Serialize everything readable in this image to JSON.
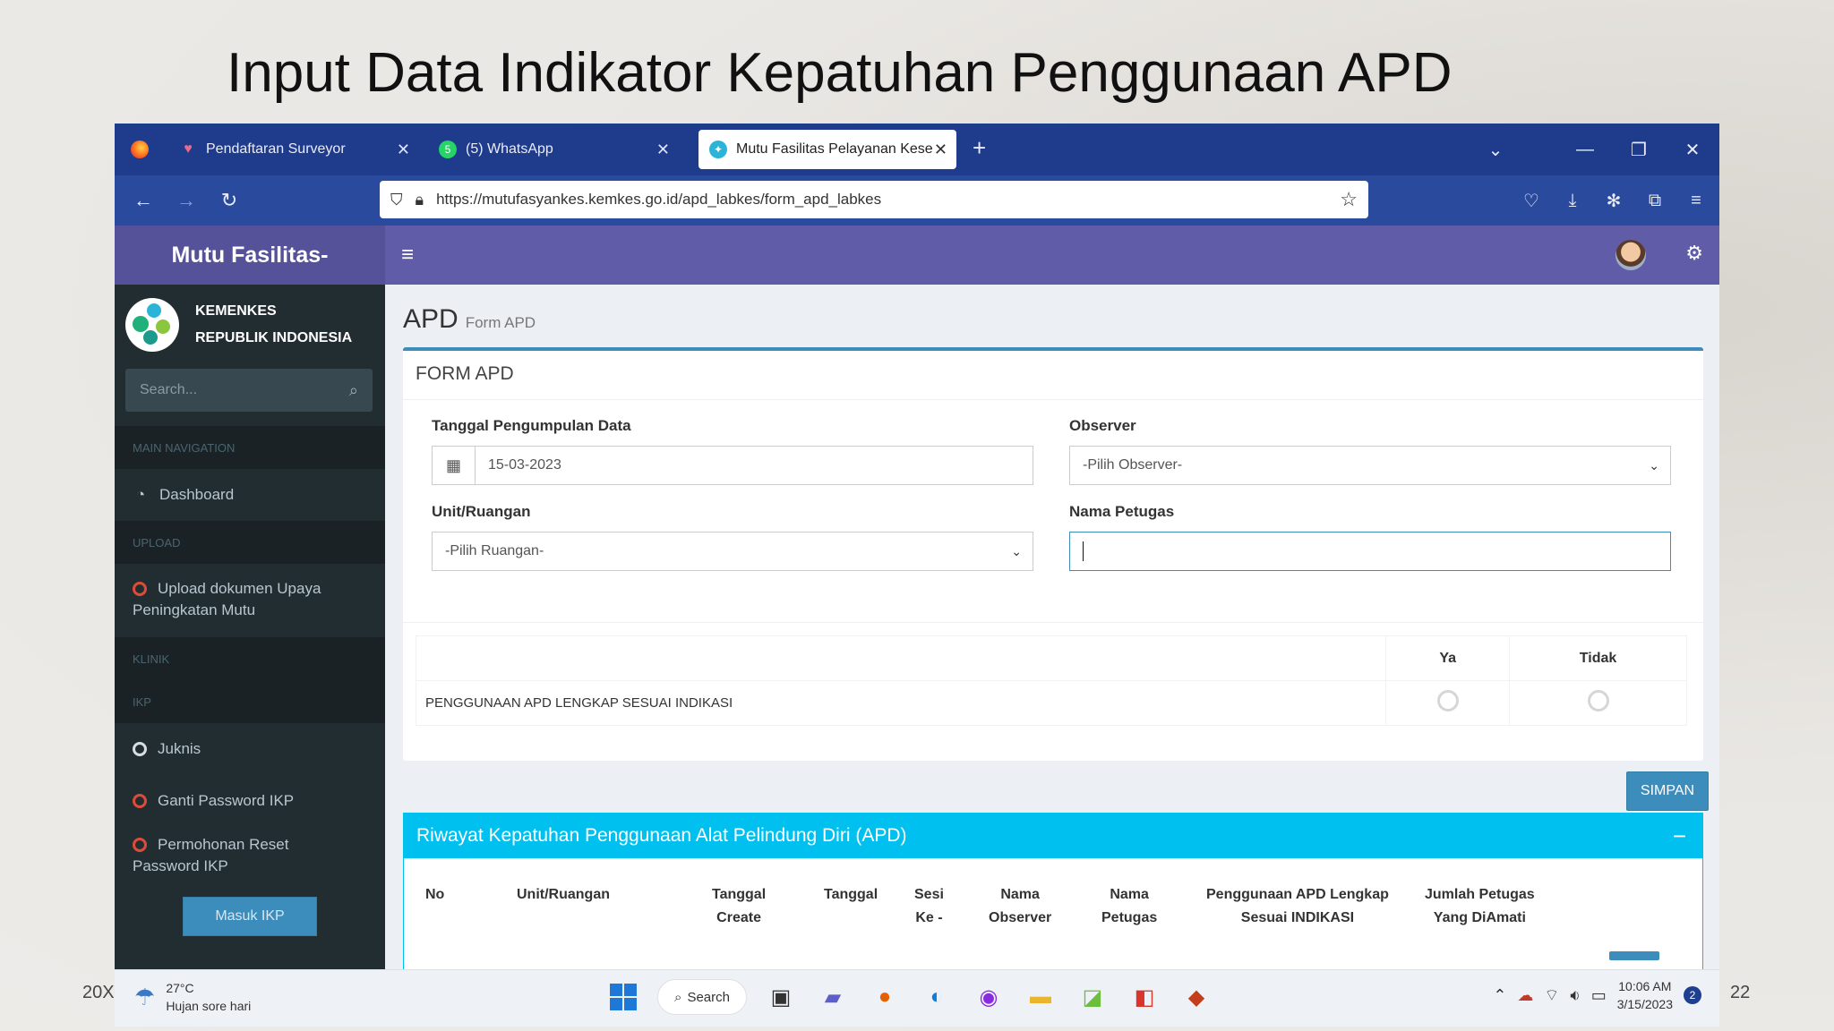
{
  "slide": {
    "title": "Input Data Indikator Kepatuhan Penggunaan APD",
    "footer_left": "20X",
    "footer_right": "22"
  },
  "browser": {
    "tabs": [
      {
        "label": "Pendaftaran Surveyor",
        "icon": "tab-heart-icon",
        "active": false
      },
      {
        "label": "(5) WhatsApp",
        "icon": "whatsapp-icon",
        "active": false
      },
      {
        "label": "Mutu Fasilitas Pelayanan Keseh",
        "icon": "kemenkes-icon",
        "active": true
      }
    ],
    "new_tab": "+",
    "url": "https://mutufasyankes.kemkes.go.id/apd_labkes/form_apd_labkes"
  },
  "app": {
    "brand": "Mutu Fasilitas-",
    "org_line1": "KEMENKES",
    "org_line2": "REPUBLIK INDONESIA",
    "search_placeholder": "Search...",
    "nav_header_main": "MAIN NAVIGATION",
    "nav_dashboard": "Dashboard",
    "nav_header_upload": "UPLOAD",
    "nav_upload_line1": "Upload dokumen Upaya",
    "nav_upload_line2": "Peningkatan Mutu",
    "nav_header_klinik": "KLINIK",
    "nav_header_ikp": "IKP",
    "nav_juknis": "Juknis",
    "nav_ganti": "Ganti Password IKP",
    "nav_reset_line1": "Permohonan Reset",
    "nav_reset_line2": "Password IKP",
    "masuk_button": "Masuk IKP"
  },
  "page": {
    "title": "APD",
    "subtitle": "Form APD",
    "form_title": "FORM APD",
    "label_tanggal": "Tanggal Pengumpulan Data",
    "value_tanggal": "15-03-2023",
    "label_observer": "Observer",
    "value_observer": "-Pilih Observer-",
    "label_unit": "Unit/Ruangan",
    "value_unit": "-Pilih Ruangan-",
    "label_nama": "Nama Petugas",
    "col_ya": "Ya",
    "col_tidak": "Tidak",
    "question": "PENGGUNAAN APD LENGKAP SESUAI INDIKASI",
    "simpan": "SIMPAN",
    "riwayat_title": "Riwayat Kepatuhan Penggunaan Alat Pelindung Diri (APD)",
    "riwayat_min": "−",
    "riwayat_cols": {
      "no": "No",
      "unit": "Unit/Ruangan",
      "tgl_create_1": "Tanggal",
      "tgl_create_2": "Create",
      "tanggal": "Tanggal",
      "sesi_1": "Sesi",
      "sesi_2": "Ke -",
      "obs_1": "Nama",
      "obs_2": "Observer",
      "pet_1": "Nama",
      "pet_2": "Petugas",
      "apd_1": "Penggunaan APD Lengkap",
      "apd_2": "Sesuai INDIKASI",
      "jml_1": "Jumlah Petugas",
      "jml_2": "Yang DiAmati"
    }
  },
  "taskbar": {
    "temp": "27°C",
    "weather": "Hujan sore hari",
    "search": "Search",
    "time": "10:06 AM",
    "date": "3/15/2023",
    "notifications": "2"
  }
}
